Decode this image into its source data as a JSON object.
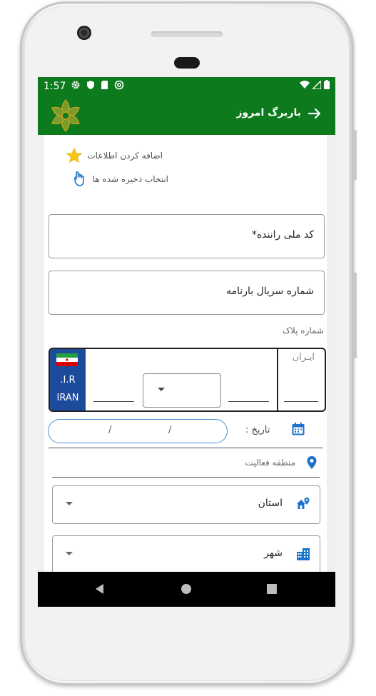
{
  "status_bar": {
    "time": "1:57"
  },
  "app_bar": {
    "title": "باربرگ امروز",
    "back_icon": "arrow-forward-icon",
    "logo_icon": "flower-logo-icon"
  },
  "quick_actions": {
    "add_info": "اضافه کردن اطلاعات",
    "select_saved": "انتخاب ذخیره شده ها"
  },
  "form": {
    "driver_national_code": "کد ملی راننده*",
    "waybill_serial": "شماره سریال بارنامه",
    "plate_label": "شماره پلاک",
    "plate": {
      "ir": ".I.R",
      "iran_en": "IRAN",
      "iran_fa": "ایـران"
    },
    "date_label": "تاریخ :",
    "date_slashes": [
      "/",
      "/"
    ],
    "activity_zone_label": "منطقه فعالیت",
    "province": "استان",
    "city": "شهر"
  },
  "colors": {
    "primary_green": "#0c7a1d",
    "star_yellow": "#f5c518",
    "plate_blue": "#1d4b9c",
    "accent_blue": "#1a73c8"
  }
}
